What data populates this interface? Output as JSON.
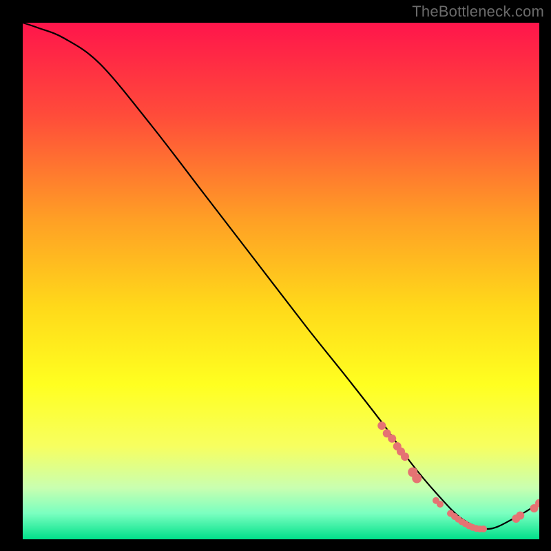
{
  "watermark": "TheBottleneck.com",
  "chart_data": {
    "type": "line",
    "title": "",
    "xlabel": "",
    "ylabel": "",
    "xlim": [
      0,
      100
    ],
    "ylim": [
      0,
      100
    ],
    "background_gradient": {
      "stops": [
        {
          "offset": 0.0,
          "color": "#ff154b"
        },
        {
          "offset": 0.18,
          "color": "#ff4c3a"
        },
        {
          "offset": 0.38,
          "color": "#ff9f25"
        },
        {
          "offset": 0.55,
          "color": "#ffd91a"
        },
        {
          "offset": 0.7,
          "color": "#ffff20"
        },
        {
          "offset": 0.82,
          "color": "#f7ff60"
        },
        {
          "offset": 0.9,
          "color": "#c9ffb0"
        },
        {
          "offset": 0.95,
          "color": "#7affc0"
        },
        {
          "offset": 1.0,
          "color": "#00e08a"
        }
      ]
    },
    "curve": {
      "x": [
        0,
        3,
        8,
        15,
        25,
        35,
        45,
        55,
        63,
        70,
        75,
        80,
        85,
        90,
        95,
        100
      ],
      "y": [
        100,
        99,
        97,
        92,
        80,
        67,
        54,
        41,
        31,
        22,
        15,
        9,
        4,
        2,
        4,
        7
      ]
    },
    "markers": {
      "color": "#e57373",
      "radius_small": 5,
      "radius_large": 7,
      "points": [
        {
          "x": 69.5,
          "y": 22.0,
          "r": 6
        },
        {
          "x": 70.5,
          "y": 20.5,
          "r": 6
        },
        {
          "x": 71.5,
          "y": 19.5,
          "r": 6
        },
        {
          "x": 72.5,
          "y": 18.0,
          "r": 6
        },
        {
          "x": 73.2,
          "y": 17.0,
          "r": 6
        },
        {
          "x": 74.0,
          "y": 16.0,
          "r": 6
        },
        {
          "x": 75.5,
          "y": 13.0,
          "r": 7
        },
        {
          "x": 76.3,
          "y": 11.8,
          "r": 7
        },
        {
          "x": 80.0,
          "y": 7.5,
          "r": 5
        },
        {
          "x": 80.8,
          "y": 6.8,
          "r": 5
        },
        {
          "x": 82.8,
          "y": 5.0,
          "r": 5
        },
        {
          "x": 83.6,
          "y": 4.4,
          "r": 5
        },
        {
          "x": 84.3,
          "y": 3.9,
          "r": 5
        },
        {
          "x": 85.0,
          "y": 3.4,
          "r": 5
        },
        {
          "x": 85.7,
          "y": 3.0,
          "r": 5
        },
        {
          "x": 86.4,
          "y": 2.6,
          "r": 5
        },
        {
          "x": 87.1,
          "y": 2.3,
          "r": 5
        },
        {
          "x": 87.8,
          "y": 2.1,
          "r": 5
        },
        {
          "x": 88.5,
          "y": 2.0,
          "r": 5
        },
        {
          "x": 89.2,
          "y": 2.0,
          "r": 5
        },
        {
          "x": 95.5,
          "y": 4.0,
          "r": 6
        },
        {
          "x": 96.3,
          "y": 4.6,
          "r": 6
        },
        {
          "x": 99.0,
          "y": 6.0,
          "r": 6
        },
        {
          "x": 100.0,
          "y": 7.0,
          "r": 6
        }
      ]
    }
  }
}
